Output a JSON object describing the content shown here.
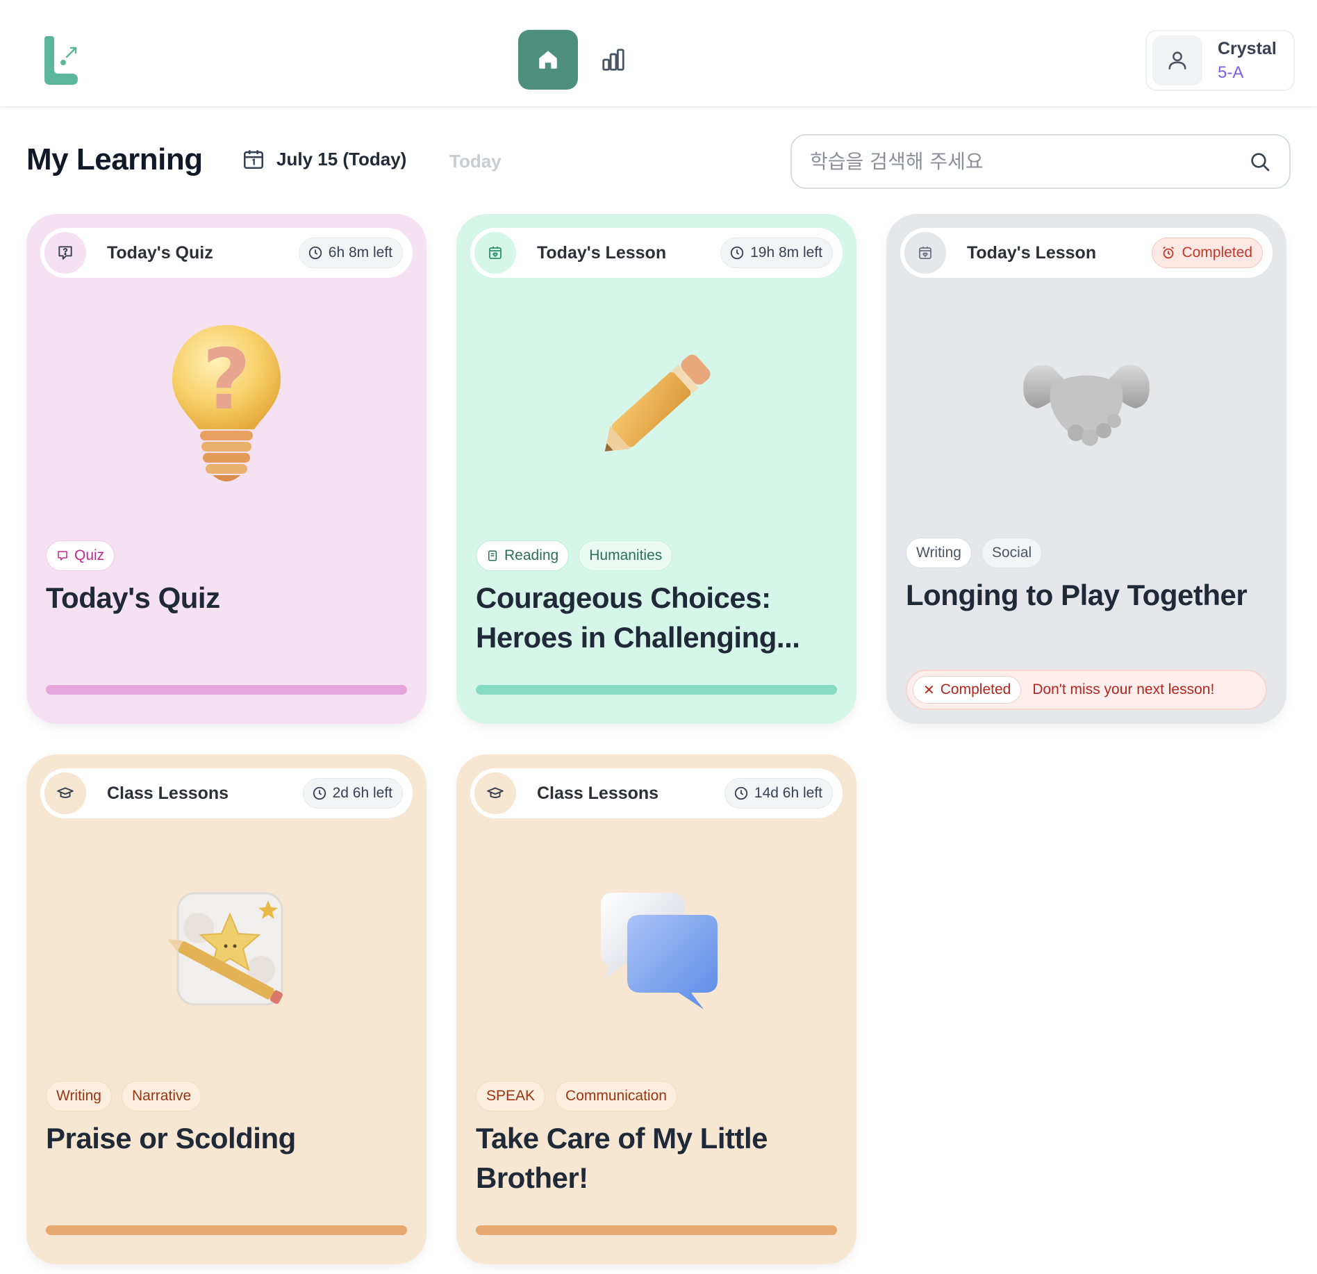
{
  "header": {
    "nav": {
      "home_label": "Home",
      "stats_label": "Stats"
    },
    "user": {
      "name": "Crystal",
      "class": "5-A"
    }
  },
  "page": {
    "title": "My Learning",
    "date": "July 15 (Today)",
    "today_link": "Today"
  },
  "search": {
    "placeholder": "학습을 검색해 주세요"
  },
  "colors": {
    "brand": "#4b8f7c",
    "quiz_bg": "#f5e1f2",
    "lesson_bg": "#d7f6ea",
    "completed_bg": "#e6e7ea",
    "class_bg": "#f6e6d2",
    "quiz_progress": "#e6a6dc",
    "lesson_progress": "#86dcc2",
    "class_progress": "#e6a86e"
  },
  "cards": [
    {
      "header": "Today's Quiz",
      "header_icon": "quiz-bubble-icon",
      "time_left": "6h 8m left",
      "illustration": "lightbulb-question",
      "tags": [
        "Quiz"
      ],
      "title": "Today's Quiz"
    },
    {
      "header": "Today's Lesson",
      "header_icon": "calendar-heart-icon",
      "time_left": "19h 8m left",
      "illustration": "pencil",
      "tags": [
        "Reading",
        "Humanities"
      ],
      "title": "Courageous Choices: Heroes in Challenging..."
    },
    {
      "header": "Today's Lesson",
      "header_icon": "calendar-heart-icon",
      "status": "Completed",
      "illustration": "handshake",
      "tags": [
        "Writing",
        "Social"
      ],
      "title": "Longing to Play Together",
      "footer_status": "Completed",
      "footer_message": "Don't miss your next lesson!"
    },
    {
      "header": "Class Lessons",
      "header_icon": "graduation-cap-icon",
      "time_left": "2d 6h left",
      "illustration": "star-pencil",
      "tags": [
        "Writing",
        "Narrative"
      ],
      "title": "Praise or Scolding"
    },
    {
      "header": "Class Lessons",
      "header_icon": "graduation-cap-icon",
      "time_left": "14d 6h left",
      "illustration": "speech-bubbles",
      "tags": [
        "SPEAK",
        "Communication"
      ],
      "title": "Take Care of My Little Brother!"
    }
  ]
}
